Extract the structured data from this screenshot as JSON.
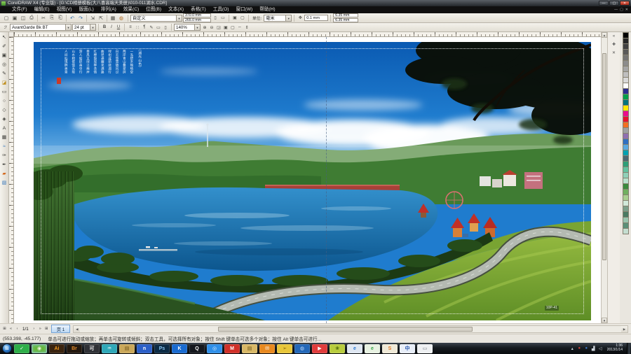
{
  "window": {
    "title": "CorelDRAW X4 (专业版) - [G:\\CD相册模板(大八喜高端天美册)\\010-011湖水.CDR]",
    "controls": {
      "minimize": "—",
      "maximize": "▢",
      "close": "✕"
    }
  },
  "menubar": {
    "items": [
      {
        "key": "file",
        "label": "文件(F)"
      },
      {
        "key": "edit",
        "label": "编辑(E)"
      },
      {
        "key": "view",
        "label": "视图(V)"
      },
      {
        "key": "layout",
        "label": "版面(L)"
      },
      {
        "key": "arrange",
        "label": "排列(A)"
      },
      {
        "key": "effects",
        "label": "效果(C)"
      },
      {
        "key": "bitmaps",
        "label": "位图(B)"
      },
      {
        "key": "text",
        "label": "文本(X)"
      },
      {
        "key": "table",
        "label": "表格(T)"
      },
      {
        "key": "tools",
        "label": "工具(O)"
      },
      {
        "key": "window",
        "label": "窗口(W)"
      },
      {
        "key": "help",
        "label": "帮助(H)"
      }
    ],
    "doc_controls": [
      "—",
      "▢",
      "✕"
    ]
  },
  "toolbar": {
    "icons": [
      {
        "name": "new",
        "glyph": "▢"
      },
      {
        "name": "open",
        "glyph": "▣"
      },
      {
        "name": "save",
        "glyph": "◫"
      },
      {
        "name": "print",
        "glyph": "⎙"
      },
      {
        "sep": true
      },
      {
        "name": "cut",
        "glyph": "✂"
      },
      {
        "name": "copy",
        "glyph": "⎘"
      },
      {
        "name": "paste",
        "glyph": "⎗"
      },
      {
        "sep": true
      },
      {
        "name": "undo",
        "glyph": "↶",
        "color": "#2a6aa8"
      },
      {
        "name": "redo",
        "glyph": "↷",
        "color": "#2a6aa8"
      },
      {
        "sep": true
      },
      {
        "name": "import",
        "glyph": "⇲"
      },
      {
        "name": "export",
        "glyph": "⇱"
      },
      {
        "sep": true
      },
      {
        "name": "app-launcher",
        "glyph": "▦"
      },
      {
        "name": "welcome",
        "glyph": "◍",
        "color": "#b06a20"
      }
    ],
    "paper_preset": "自定义",
    "paper_width": "370.0 mm",
    "paper_height": "265.0 mm",
    "units_label": "单位:",
    "units": "毫米",
    "nudge": "0.1 mm",
    "duplicate_x": "6.35 mm",
    "duplicate_y": "6.35 mm"
  },
  "propertybar": {
    "font": "AvantGarde Bk BT",
    "font_size": "24 pt",
    "style_buttons": [
      {
        "name": "bold",
        "glyph": "B",
        "cls": "bold"
      },
      {
        "name": "italic",
        "glyph": "I",
        "cls": "ital"
      },
      {
        "name": "underline",
        "glyph": "U",
        "cls": "undl"
      }
    ],
    "para_buttons": [
      {
        "name": "alignment",
        "glyph": "≡"
      },
      {
        "name": "bullet-list",
        "glyph": "∷"
      },
      {
        "name": "drop-cap",
        "glyph": "¶"
      },
      {
        "name": "edit-text",
        "glyph": "✎"
      },
      {
        "name": "horizontal-text",
        "glyph": "▭"
      },
      {
        "name": "vertical-text",
        "glyph": "▯"
      }
    ],
    "zoom": "140%",
    "zoom_buttons": [
      {
        "name": "zoom-in",
        "glyph": "⊕"
      },
      {
        "name": "zoom-out",
        "glyph": "⊖"
      },
      {
        "name": "zoom-selected",
        "glyph": "◲"
      },
      {
        "name": "zoom-all-objects",
        "glyph": "▣"
      },
      {
        "name": "zoom-page",
        "glyph": "▢"
      },
      {
        "name": "zoom-page-width",
        "glyph": "⇔"
      },
      {
        "name": "zoom-page-height",
        "glyph": "⇕"
      }
    ]
  },
  "toolbox": {
    "tools": [
      {
        "name": "pick",
        "glyph": "↖"
      },
      {
        "name": "shape",
        "glyph": "✐"
      },
      {
        "name": "crop",
        "glyph": "▣"
      },
      {
        "name": "zoom",
        "glyph": "◎"
      },
      {
        "name": "freehand",
        "glyph": "✎"
      },
      {
        "name": "smart-fill",
        "glyph": "◪",
        "color": "#c09020"
      },
      {
        "name": "rectangle",
        "glyph": "▭"
      },
      {
        "name": "ellipse",
        "glyph": "○"
      },
      {
        "name": "polygon",
        "glyph": "◇"
      },
      {
        "name": "basic-shapes",
        "glyph": "◈"
      },
      {
        "name": "text",
        "glyph": "A"
      },
      {
        "name": "table",
        "glyph": "▦"
      },
      {
        "name": "interactive-blend",
        "glyph": "≈",
        "color": "#3a7abd"
      },
      {
        "name": "eyedropper",
        "glyph": "✑"
      },
      {
        "name": "outline-pen",
        "glyph": "✒"
      },
      {
        "name": "fill",
        "glyph": "▰",
        "color": "#d4691e"
      },
      {
        "name": "interactive-fill",
        "glyph": "▨",
        "color": "#3a7abd"
      }
    ]
  },
  "docker": {
    "icons": [
      {
        "name": "collapse-chevrons",
        "glyph": "«"
      },
      {
        "name": "pin",
        "glyph": "✚"
      },
      {
        "name": "close",
        "glyph": "✕"
      }
    ]
  },
  "palette": {
    "colors": [
      "#000000",
      "#262626",
      "#404040",
      "#595959",
      "#737373",
      "#8c8c8c",
      "#a6a6a6",
      "#bfbfbf",
      "#d9d9d9",
      "#ffffff",
      "#2b2c8f",
      "#009e49",
      "#00747c",
      "#ffe800",
      "#ec0c8c",
      "#e8112d",
      "#f36f21",
      "#9ea0a3",
      "#8f6fb0",
      "#2f6fc2",
      "#5aa8e0",
      "#00a0b0",
      "#4a6670",
      "#2e9e78",
      "#62c2a0",
      "#8fd0b8",
      "#b8e0cc",
      "#3a8a3c",
      "#70b060",
      "#a8cf90",
      "#d0e8da",
      "#7a9e8a",
      "#4a7a62",
      "#98c4ae",
      "#5a8f78",
      "#c4ddd0"
    ]
  },
  "page_nav": {
    "buttons_left": [
      {
        "name": "add-page",
        "glyph": "⊞"
      },
      {
        "name": "first-page",
        "glyph": "«"
      },
      {
        "name": "prev-page",
        "glyph": "‹"
      }
    ],
    "pages": "1/1",
    "buttons_right": [
      {
        "name": "next-page",
        "glyph": "›"
      },
      {
        "name": "last-page",
        "glyph": "»"
      },
      {
        "name": "add-page-end",
        "glyph": "⊞"
      }
    ],
    "tab": "页 1"
  },
  "statusbar": {
    "coords": "(553.398, -45.177)",
    "hint": "单击可进行拖动或缩放；再单击可旋转或倾斜；双击工具，可选择所有对象；按住 Shift 键单击可选多个对象；按住 Alt 键单击可进行..."
  },
  "taskbar": {
    "start_glyph": "⊞",
    "apps": [
      {
        "name": "antivirus",
        "glyph": "✓",
        "bg": "#2fae49",
        "fg": "#ffffff"
      },
      {
        "name": "coreldraw",
        "glyph": "◉",
        "bg": "#67b83e",
        "fg": "#eaf6df",
        "active": true
      },
      {
        "name": "illustrator",
        "glyph": "Ai",
        "bg": "#3a2410",
        "fg": "#f09a1e"
      },
      {
        "name": "bridge",
        "glyph": "Br",
        "bg": "#23180e",
        "fg": "#e08a2a"
      },
      {
        "name": "docs-app",
        "glyph": "可",
        "bg": "#2f3136",
        "fg": "#eeeeee"
      },
      {
        "name": "media-app",
        "glyph": "♒",
        "bg": "#2fa8b8",
        "fg": "#ffffff"
      },
      {
        "name": "pictures-folder",
        "glyph": "▤",
        "bg": "#caa85a",
        "fg": "#6a4f18"
      },
      {
        "name": "n-app",
        "glyph": "n",
        "bg": "#2b5fc7",
        "fg": "#ffffff"
      },
      {
        "name": "photoshop",
        "glyph": "Ps",
        "bg": "#0c2b45",
        "fg": "#8ac4f0"
      },
      {
        "name": "k-player",
        "glyph": "K",
        "bg": "#1a6bd0",
        "fg": "#ffffff"
      },
      {
        "name": "qq",
        "glyph": "Q",
        "bg": "#15181e",
        "fg": "#f8f8f8"
      },
      {
        "name": "browser-swirl",
        "glyph": "◎",
        "bg": "#2f8fe8",
        "fg": "#d8ecff"
      },
      {
        "name": "m-app",
        "glyph": "M",
        "bg": "#d03028",
        "fg": "#ffffff"
      },
      {
        "name": "folder",
        "glyph": "▤",
        "bg": "#d8b867",
        "fg": "#6a5216"
      },
      {
        "name": "foxmail",
        "glyph": "✉",
        "bg": "#e8891f",
        "fg": "#ffffff"
      },
      {
        "name": "kingsoft-bird",
        "glyph": "➢",
        "bg": "#e8c63a",
        "fg": "#8a6a10"
      },
      {
        "name": "globe-browser",
        "glyph": "◍",
        "bg": "#2468b8",
        "fg": "#bcd8f8"
      },
      {
        "name": "pps-player",
        "glyph": "▶",
        "bg": "#e03c3c",
        "fg": "#ffffff"
      },
      {
        "name": "green-bird",
        "glyph": "❀",
        "bg": "#b8cc3e",
        "fg": "#4f6a10"
      },
      {
        "name": "ie",
        "glyph": "e",
        "bg": "#dfe7f2",
        "fg": "#2a7ad4"
      },
      {
        "name": "browser-360",
        "glyph": "e",
        "bg": "#e8f2e2",
        "fg": "#38a848"
      },
      {
        "name": "sogou",
        "glyph": "S",
        "bg": "#f0ead8",
        "fg": "#e07828"
      },
      {
        "name": "input-method",
        "glyph": "中",
        "bg": "#e8eef8",
        "fg": "#2858b0"
      },
      {
        "name": "usb-drive",
        "glyph": "▭",
        "bg": "#eef0f2",
        "fg": "#7a8088"
      }
    ],
    "tray": [
      {
        "name": "hidden-icons",
        "glyph": "▴",
        "fg": "#cfd6dd"
      },
      {
        "name": "tray-security",
        "glyph": "●",
        "fg": "#d04038"
      },
      {
        "name": "tray-app",
        "glyph": "●",
        "fg": "#3a78c8"
      },
      {
        "name": "network",
        "glyph": "▟",
        "fg": "#cfd6dd"
      },
      {
        "name": "volume",
        "glyph": "◁",
        "fg": "#cfd6dd"
      }
    ],
    "clock_time": "1:36",
    "clock_date": "2013/1/14"
  },
  "photo": {
    "poem": [
      "（湖光山色）",
      "一泓碧水映晴空",
      "两岸青山叠翠屏",
      "白云悠悠随风过",
      "绿树成荫绕湖行",
      "曲径通幽花满路",
      "红楼隐现柳含情",
      "春风又绿江南岸",
      "游人如织画中行",
      "山水相依情无限",
      "人间仙境醉美景"
    ],
    "corner_label": "10P-41"
  }
}
